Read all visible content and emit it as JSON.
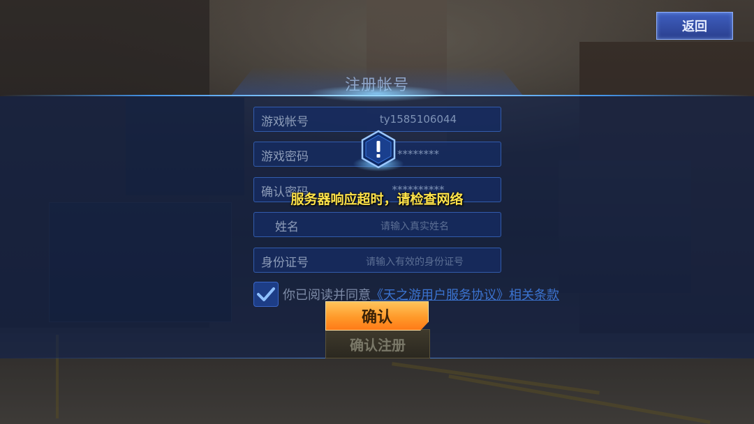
{
  "header": {
    "back_label": "返回",
    "title": "注册帐号"
  },
  "form": {
    "account": {
      "label": "游戏帐号",
      "value": "ty1585106044"
    },
    "password": {
      "label": "游戏密码",
      "value": "********"
    },
    "confirm_password": {
      "label": "确认密码",
      "value": "**********"
    },
    "name": {
      "label": "姓名",
      "placeholder": "请输入真实姓名"
    },
    "id_number": {
      "label": "身份证号",
      "placeholder": "请输入有效的身份证号"
    },
    "agreement": {
      "checked": true,
      "text": "你已阅读并同意",
      "link": "《天之游用户服务协议》相关条款"
    },
    "submit_label": "确认注册"
  },
  "dialog": {
    "icon": "alert-icon",
    "message": "服务器响应超时，请检查网络",
    "ok_label": "确认"
  },
  "colors": {
    "accent_blue": "#3b73d0",
    "alert_text": "#ffe34a",
    "ok_button": "#ff9a2a"
  }
}
